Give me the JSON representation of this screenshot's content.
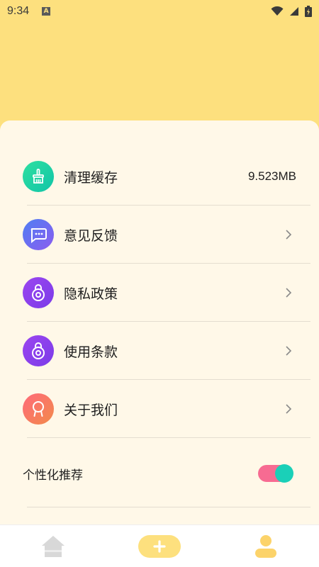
{
  "status_bar": {
    "time": "9:34",
    "notification_badge": "A"
  },
  "settings": {
    "items": [
      {
        "label": "清理缓存",
        "value": "9.523MB",
        "icon": "broom-icon",
        "color_start": "#2ee0a0",
        "color_end": "#11c4a8"
      },
      {
        "label": "意见反馈",
        "value": "",
        "icon": "chat-bubble-icon",
        "color_start": "#4f7ff2",
        "color_end": "#8b5cf0"
      },
      {
        "label": "隐私政策",
        "value": "",
        "icon": "lock-icon",
        "color_start": "#9b46f0",
        "color_end": "#7b3be8"
      },
      {
        "label": "使用条款",
        "value": "",
        "icon": "lock-icon",
        "color_start": "#9b46f0",
        "color_end": "#7b3be8"
      },
      {
        "label": "关于我们",
        "value": "",
        "icon": "badge-icon",
        "color_start": "#ff6a7a",
        "color_end": "#f28a4a"
      }
    ],
    "personalized_recommendation": {
      "label": "个性化推荐",
      "enabled": true
    }
  },
  "tabbar": {
    "tabs": [
      {
        "icon": "home-icon"
      },
      {
        "icon": "add-icon"
      },
      {
        "icon": "profile-icon"
      }
    ]
  },
  "colors": {
    "header_bg": "#fde07e",
    "card_bg": "#fff8e8",
    "toggle_track": "#f76b92",
    "toggle_knob": "#1ad0b8"
  }
}
